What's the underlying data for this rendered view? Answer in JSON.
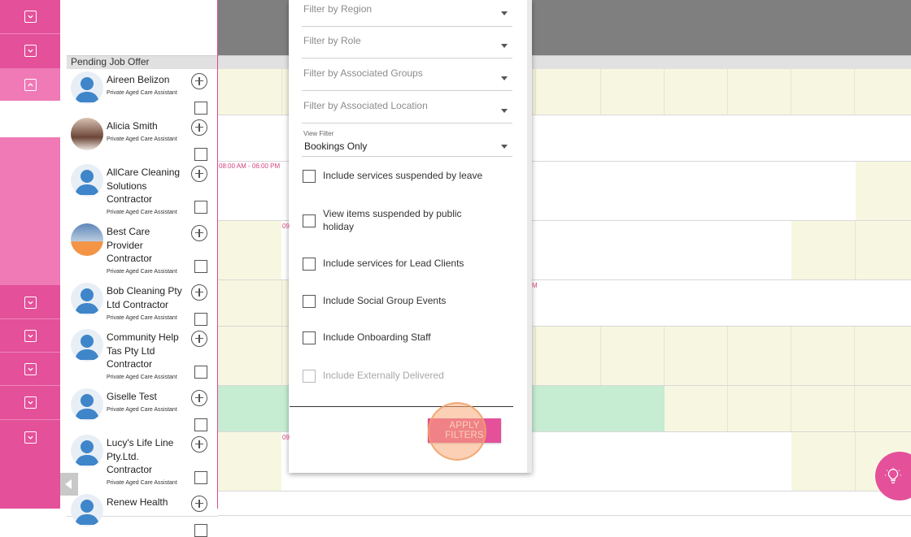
{
  "grid": {
    "section_header": "Pending Job Offer",
    "staff": [
      {
        "name": "Aireen Belizon",
        "role": "Private Aged Care Assistant"
      },
      {
        "name": "Alicia Smith",
        "role": "Private Aged Care Assistant"
      },
      {
        "name": "AllCare Cleaning Solutions Contractor",
        "role": "Private Aged Care Assistant"
      },
      {
        "name": "Best Care Provider Contractor",
        "role": "Private Aged Care Assistant"
      },
      {
        "name": "Bob Cleaning Pty Ltd Contractor",
        "role": "Private Aged Care Assistant"
      },
      {
        "name": "Community Help Tas Pty Ltd Contractor",
        "role": "Private Aged Care Assistant"
      },
      {
        "name": "Giselle Test",
        "role": "Private Aged Care Assistant"
      },
      {
        "name": "Lucy's Life Line Pty.Ltd. Contractor",
        "role": "Private Aged Care Assistant"
      },
      {
        "name": "Renew Health",
        "role": ""
      }
    ],
    "time_label_allcare": "08:00 AM - 06:00 PM",
    "partial_time_1": "09",
    "partial_time_2": "M",
    "partial_time_3": "09"
  },
  "filters": {
    "region_placeholder": "Filter by Region",
    "role_placeholder": "Filter by Role",
    "groups_placeholder": "Filter by Associated Groups",
    "location_placeholder": "Filter by Associated Location",
    "view_filter_label": "View Filter",
    "view_filter_value": "Bookings Only",
    "options": [
      {
        "label": "Include services suspended by leave",
        "checked": false
      },
      {
        "label": "View items suspended by public holiday",
        "checked": false
      },
      {
        "label": "Include services for Lead Clients",
        "checked": false
      },
      {
        "label": "Include Social Group Events",
        "checked": false
      },
      {
        "label": "Include Onboarding Staff",
        "checked": false
      },
      {
        "label": "Include Externally Delivered",
        "checked": false,
        "disabled": true
      }
    ],
    "apply_label": "APPLY FILTERS"
  },
  "colors": {
    "brand_pink": "#e4509a",
    "rail_light_pink": "#ef7ab6",
    "cell_cream": "#f7f7e1",
    "cell_green": "#c6ecd2",
    "header_grey": "#7f7f7f"
  },
  "icons": {
    "rail_toggle": "chevron-down-icon",
    "rail_toggle_active": "chevron-up-icon",
    "help_fab": "lightbulb-icon",
    "collapse_tab": "caret-left-icon"
  }
}
